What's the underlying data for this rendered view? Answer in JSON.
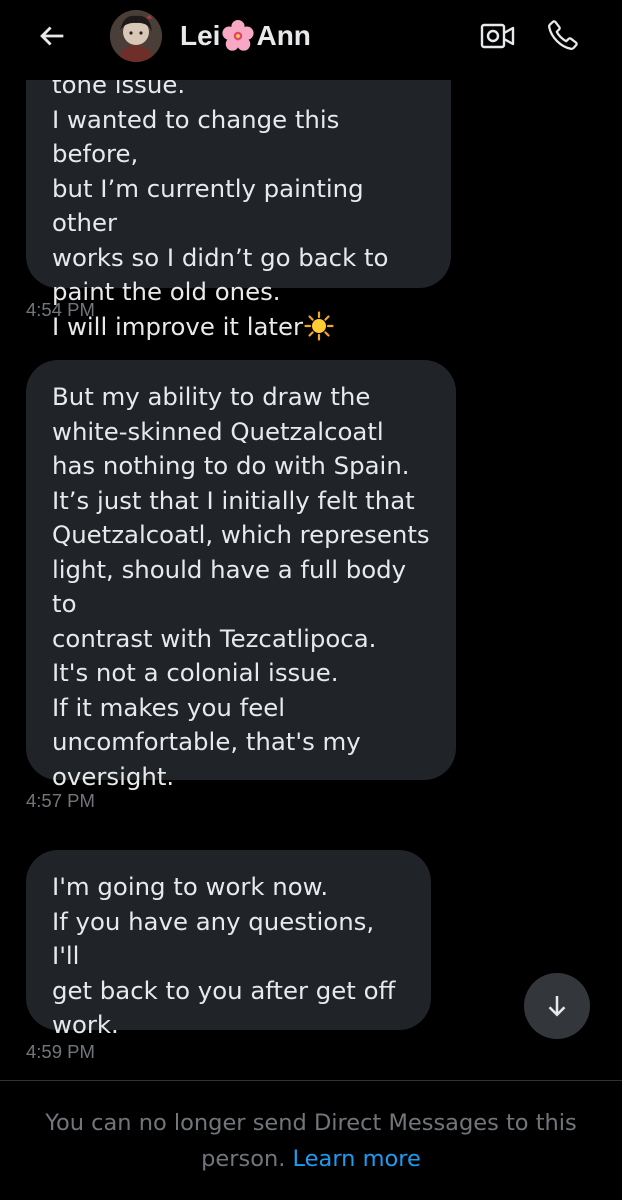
{
  "header": {
    "name_part1": "Lei",
    "name_flower_emoji": "cherry-blossom",
    "name_part2": "Ann",
    "back_icon": "arrow-left-icon",
    "video_icon": "video-camera-icon",
    "call_icon": "phone-icon"
  },
  "messages": [
    {
      "text": "tone issue.\nI wanted to change this before,\nbut I’m currently painting other\nworks so I didn’t go back to\npaint the old ones.\nI will improve it later",
      "trailing_emoji": "sun",
      "time": "4:54 PM"
    },
    {
      "text": "But my ability to draw the\nwhite-skinned Quetzalcoatl\nhas nothing to do with Spain.\nIt’s just that I initially felt that\nQuetzalcoatl, which represents\nlight, should have a full body to\ncontrast with Tezcatlipoca.\nIt's not a colonial issue.\nIf it makes you feel\nuncomfortable, that's my\noversight.",
      "time": "4:57 PM"
    },
    {
      "text": "I'm going to work now.\n If you have any questions, I'll\nget back to you after get off\nwork.",
      "time": "4:59 PM"
    }
  ],
  "scroll_down_icon": "arrow-down-icon",
  "footer": {
    "notice": "You can no longer send Direct Messages to this person.",
    "learn_more": "Learn more"
  },
  "colors": {
    "background": "#000000",
    "bubble": "#202327",
    "text": "#e7e9ea",
    "muted": "#71767b",
    "link": "#1d9bf0"
  }
}
